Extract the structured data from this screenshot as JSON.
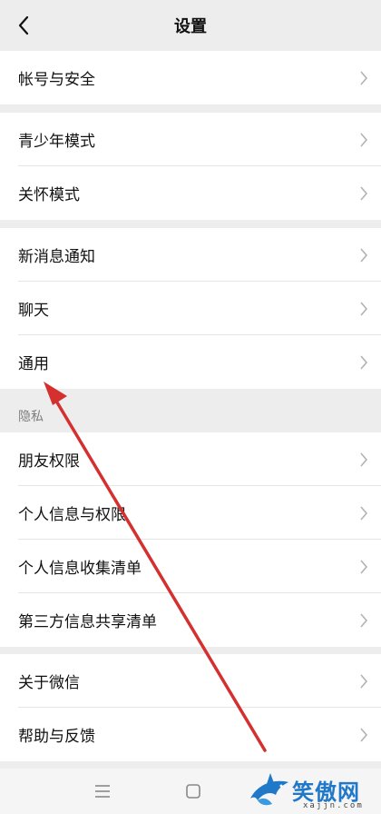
{
  "header": {
    "title": "设置"
  },
  "sections": {
    "account": [
      {
        "label": "帐号与安全"
      }
    ],
    "modes": [
      {
        "label": "青少年模式"
      },
      {
        "label": "关怀模式"
      }
    ],
    "general": [
      {
        "label": "新消息通知"
      },
      {
        "label": "聊天"
      },
      {
        "label": "通用"
      }
    ],
    "privacy_header": "隐私",
    "privacy": [
      {
        "label": "朋友权限"
      },
      {
        "label": "个人信息与权限"
      },
      {
        "label": "个人信息收集清单"
      },
      {
        "label": "第三方信息共享清单"
      }
    ],
    "about": [
      {
        "label": "关于微信"
      },
      {
        "label": "帮助与反馈"
      }
    ]
  },
  "watermark": {
    "brand": "笑傲网",
    "domain": "xajjn.com"
  },
  "annotation_color": "#d4302f"
}
